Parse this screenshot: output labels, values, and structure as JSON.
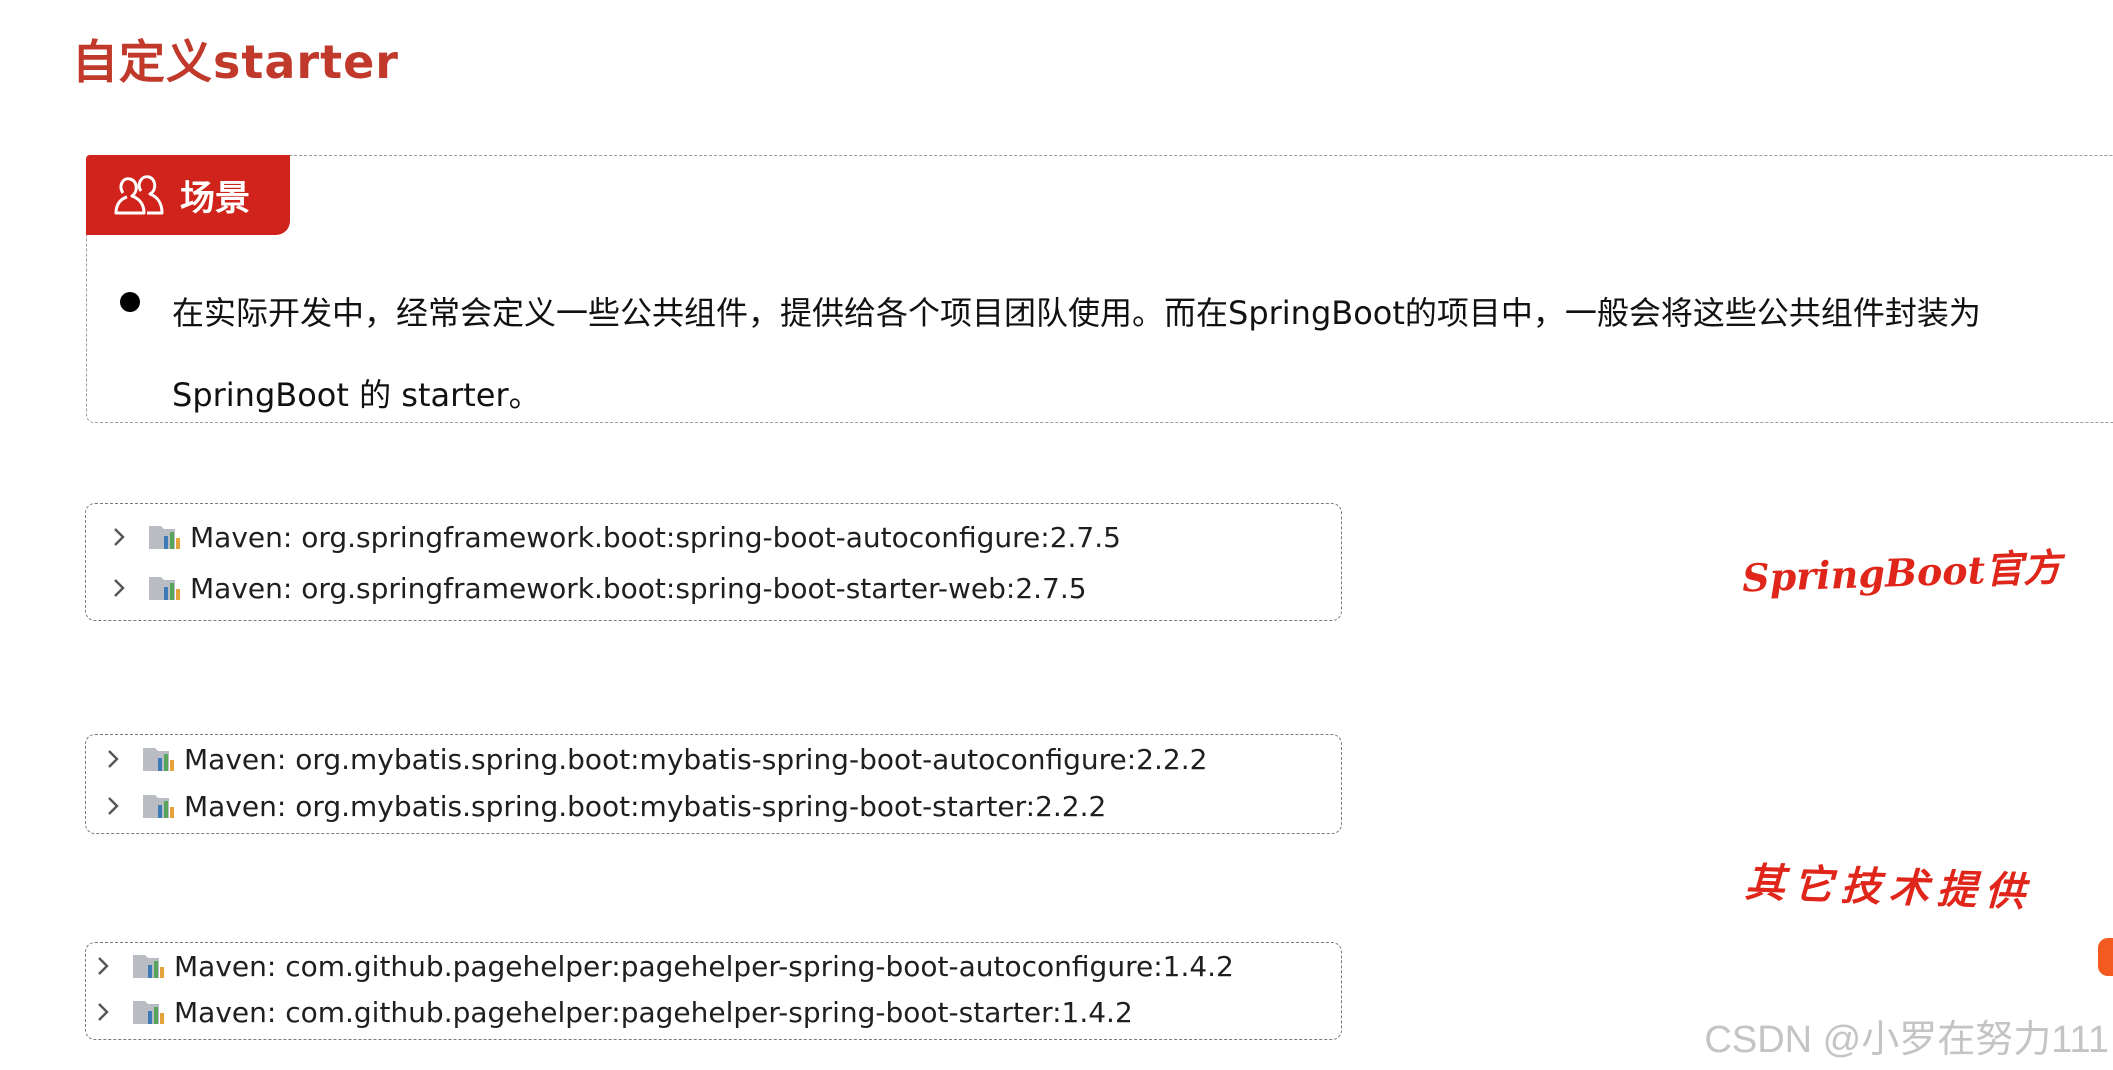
{
  "title": "自定义starter",
  "scene": {
    "tag_label": "场景",
    "text": "在实际开发中，经常会定义一些公共组件，提供给各个项目团队使用。而在SpringBoot的项目中，一般会将这些公共组件封装为SpringBoot 的 starter。"
  },
  "dependency_groups": [
    {
      "items": [
        "Maven: org.springframework.boot:spring-boot-autoconfigure:2.7.5",
        "Maven: org.springframework.boot:spring-boot-starter-web:2.7.5"
      ]
    },
    {
      "items": [
        "Maven: org.mybatis.spring.boot:mybatis-spring-boot-autoconfigure:2.2.2",
        "Maven: org.mybatis.spring.boot:mybatis-spring-boot-starter:2.2.2"
      ]
    },
    {
      "items": [
        "Maven: com.github.pagehelper:pagehelper-spring-boot-autoconfigure:1.4.2",
        "Maven: com.github.pagehelper:pagehelper-spring-boot-starter:1.4.2"
      ]
    }
  ],
  "annotations": {
    "official": "SpringBoot官方",
    "third_party": "其它技术提供"
  },
  "watermark": "CSDN @小罗在努力111",
  "colors": {
    "title": "#c0392b",
    "tag_background": "#d0231b",
    "annotation": "#e0261b",
    "watermark": "#c4c4c4"
  },
  "icons": {
    "scene_tag": "users-icon",
    "row_expand": "chevron-right-icon",
    "library": "library-icon"
  }
}
